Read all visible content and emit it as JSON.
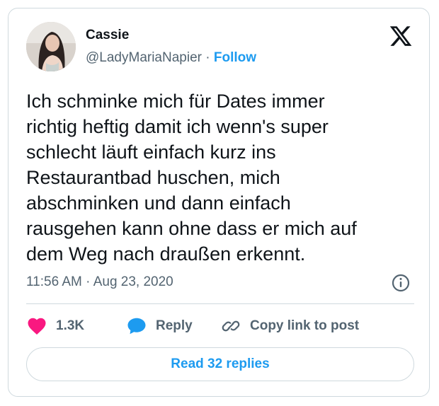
{
  "tweet": {
    "author_name": "Cassie",
    "handle": "@LadyMariaNapier",
    "separator": "·",
    "follow_label": "Follow",
    "text": "Ich schminke mich für Dates immer\nrichtig heftig damit ich wenn's super\nschlecht läuft einfach kurz ins\nRestaurantbad huschen, mich\nabschminken und dann einfach\nrausgehen kann ohne dass er mich auf\ndem Weg nach draußen erkennt.",
    "timestamp": "11:56 AM · Aug 23, 2020"
  },
  "actions": {
    "like_count": "1.3K",
    "reply_label": "Reply",
    "copy_link_label": "Copy link to post"
  },
  "read_replies_label": "Read 32 replies",
  "colors": {
    "accent": "#1d9bf0",
    "like": "#f91880",
    "text": "#0f1419",
    "muted": "#536471",
    "border": "#cfd9de"
  },
  "icons": [
    "x-logo-icon",
    "info-icon",
    "heart-icon",
    "reply-bubble-icon",
    "link-icon"
  ]
}
